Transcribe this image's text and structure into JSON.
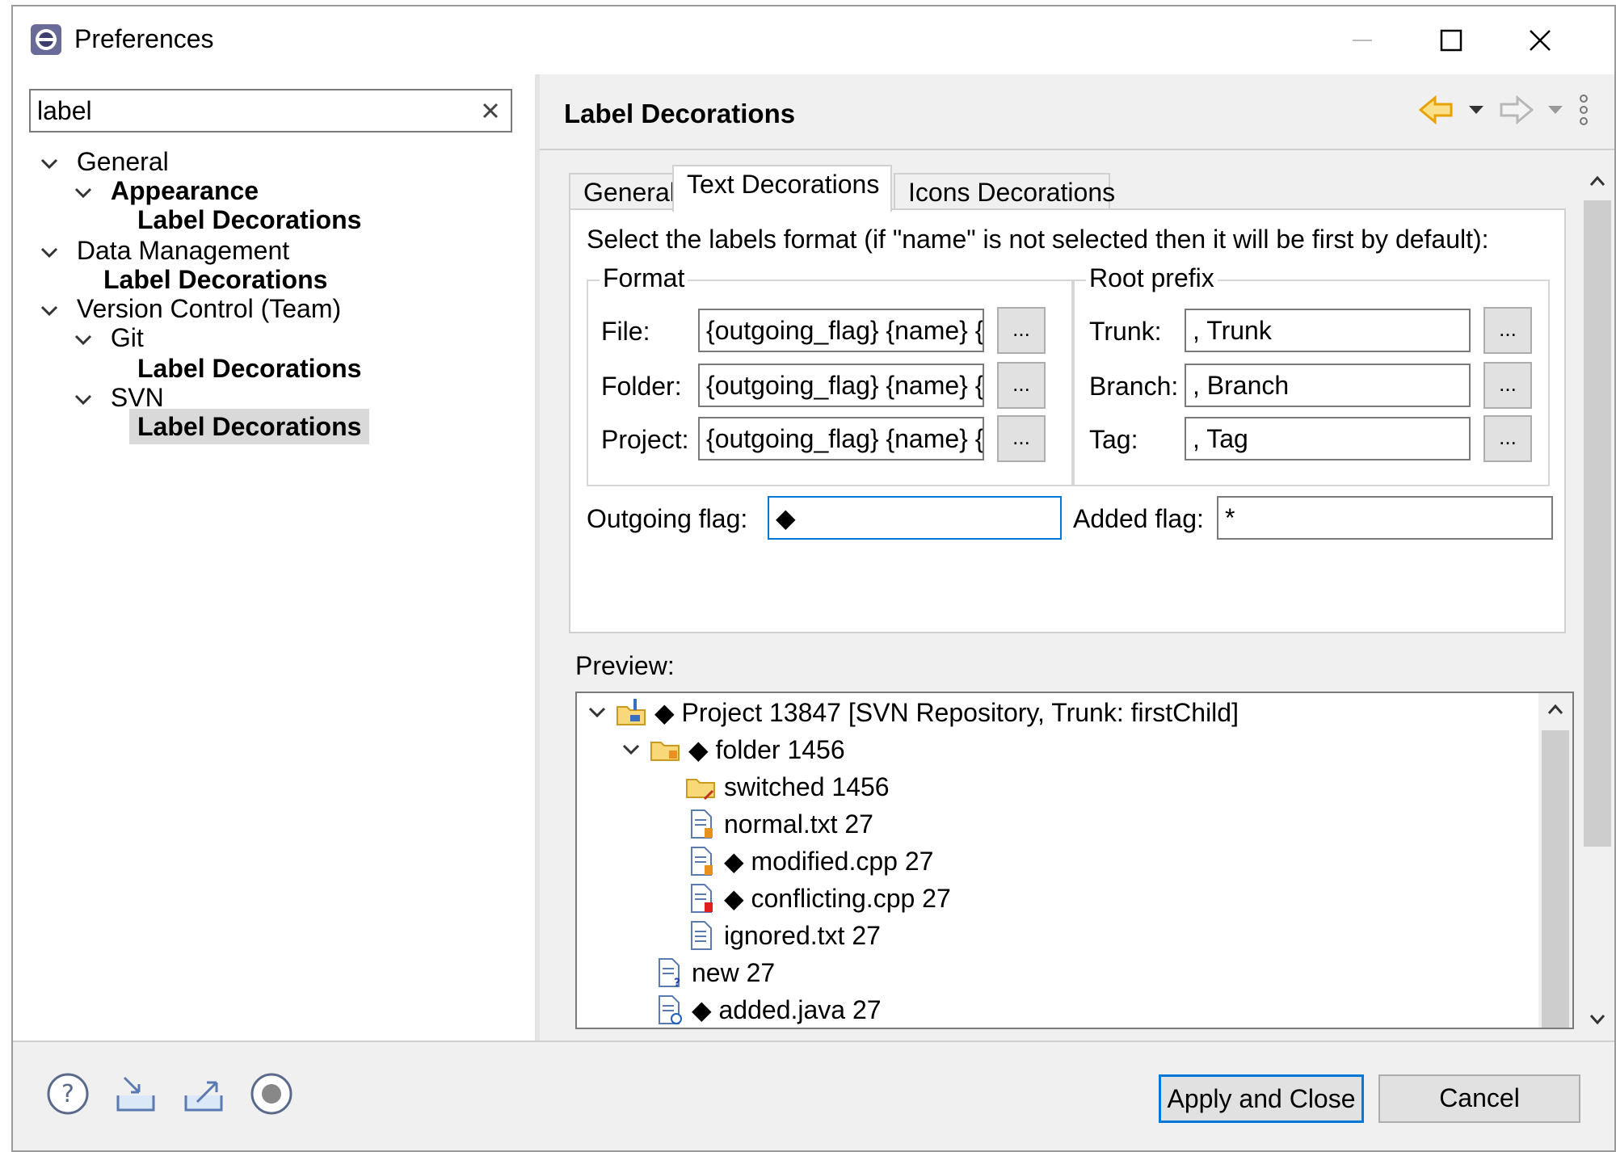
{
  "window": {
    "title": "Preferences"
  },
  "filter": {
    "value": "label"
  },
  "tree": [
    {
      "label": "General",
      "bold": false
    },
    {
      "label": "Appearance",
      "bold": true
    },
    {
      "label": "Label Decorations",
      "bold": true
    },
    {
      "label": "Data Management",
      "bold": false
    },
    {
      "label": "Label Decorations",
      "bold": true
    },
    {
      "label": "Version Control (Team)",
      "bold": false
    },
    {
      "label": "Git",
      "bold": false
    },
    {
      "label": "Label Decorations",
      "bold": true
    },
    {
      "label": "SVN",
      "bold": false
    },
    {
      "label": "Label Decorations",
      "bold": true,
      "selected": true
    }
  ],
  "page": {
    "title": "Label Decorations"
  },
  "tabs": [
    {
      "label": "General"
    },
    {
      "label": "Text Decorations",
      "active": true
    },
    {
      "label": "Icons Decorations"
    }
  ],
  "text_decorations": {
    "description": "Select the labels format (if \"name\" is not selected then it will be first by default):",
    "format_group": {
      "title": "Format",
      "rows": [
        {
          "label": "File:",
          "value": "{outgoing_flag} {name} {"
        },
        {
          "label": "Folder:",
          "value": "{outgoing_flag} {name} {"
        },
        {
          "label": "Project:",
          "value": "{outgoing_flag} {name} {"
        }
      ]
    },
    "root_prefix_group": {
      "title": "Root prefix",
      "rows": [
        {
          "label": "Trunk:",
          "value": ", Trunk"
        },
        {
          "label": "Branch:",
          "value": ", Branch"
        },
        {
          "label": "Tag:",
          "value": ", Tag"
        }
      ]
    },
    "browse_label": "...",
    "outgoing_flag": {
      "label": "Outgoing flag:",
      "value": "◆"
    },
    "added_flag": {
      "label": "Added flag:",
      "value": "*"
    }
  },
  "preview": {
    "label": "Preview:",
    "items": [
      {
        "text": "◆ Project 13847 [SVN Repository, Trunk: firstChild]",
        "icon": "project-icon"
      },
      {
        "text": "◆ folder 1456",
        "icon": "folder-icon"
      },
      {
        "text": "switched 1456",
        "icon": "switched-folder-icon"
      },
      {
        "text": "normal.txt 27",
        "icon": "file-icon"
      },
      {
        "text": "◆ modified.cpp 27",
        "icon": "modified-file-icon"
      },
      {
        "text": "◆ conflicting.cpp 27",
        "icon": "conflict-file-icon"
      },
      {
        "text": "ignored.txt 27",
        "icon": "ignored-file-icon"
      },
      {
        "text": "new 27",
        "icon": "new-file-icon"
      },
      {
        "text": "◆ added.java 27",
        "icon": "added-file-icon"
      }
    ]
  },
  "buttons": {
    "apply_close": "Apply and Close",
    "cancel": "Cancel"
  },
  "colors": {
    "accent": "#0078d7",
    "nav_back": "#e8a200"
  }
}
